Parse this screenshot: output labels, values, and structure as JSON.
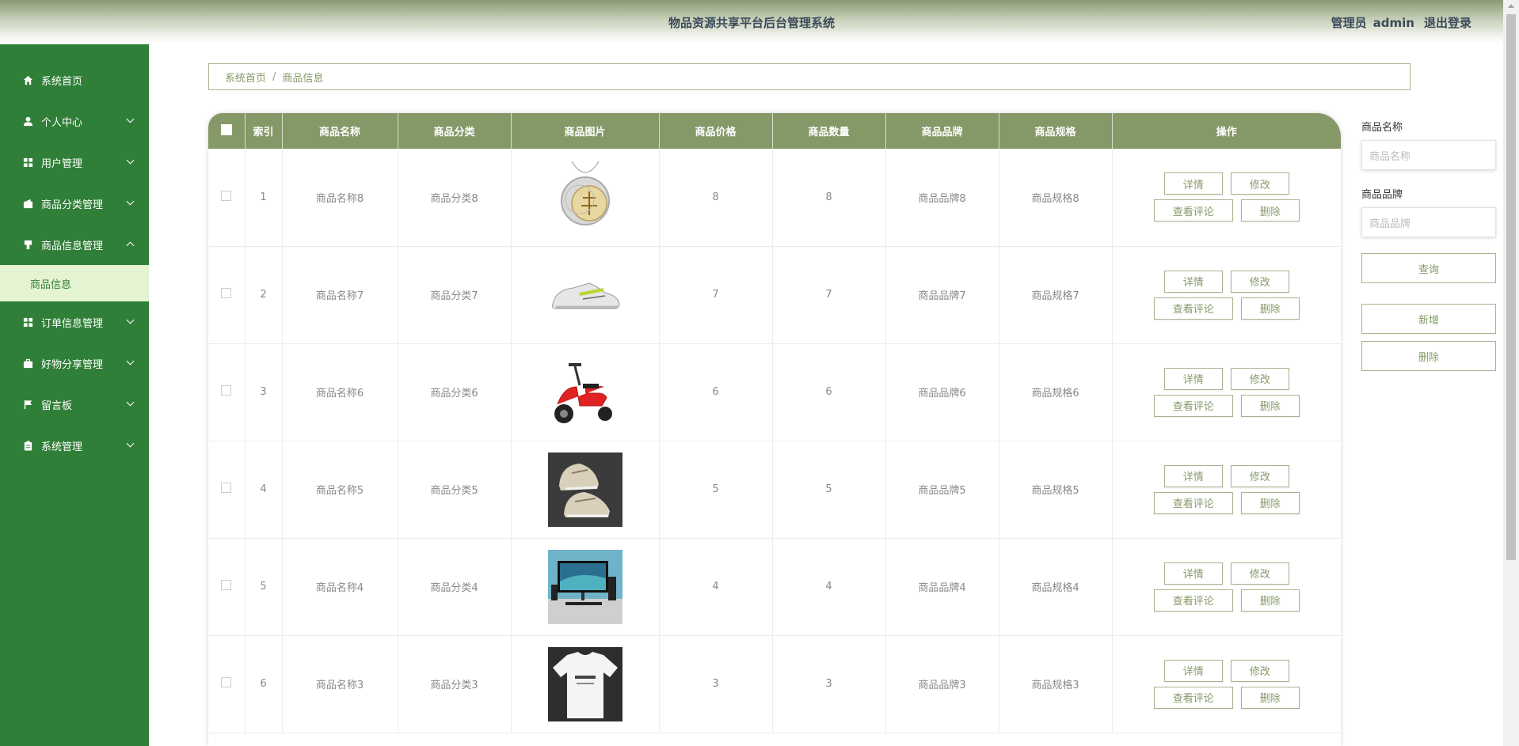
{
  "header": {
    "title": "物品资源共享平台后台管理系统",
    "role": "管理员",
    "username": "admin",
    "logout": "退出登录"
  },
  "sidebar": {
    "items": [
      {
        "label": "系统首页",
        "icon": "home-icon"
      },
      {
        "label": "个人中心",
        "icon": "user-icon"
      },
      {
        "label": "用户管理",
        "icon": "grid-icon"
      },
      {
        "label": "商品分类管理",
        "icon": "wallet-icon"
      },
      {
        "label": "商品信息管理",
        "icon": "cup-icon"
      },
      {
        "label": "订单信息管理",
        "icon": "grid-icon"
      },
      {
        "label": "好物分享管理",
        "icon": "briefcase-icon"
      },
      {
        "label": "留言板",
        "icon": "flag-icon"
      },
      {
        "label": "系统管理",
        "icon": "clipboard-icon"
      }
    ],
    "subitem": "商品信息"
  },
  "breadcrumb": {
    "home": "系统首页",
    "sep": "/",
    "current": "商品信息"
  },
  "table": {
    "headers": [
      "索引",
      "商品名称",
      "商品分类",
      "商品图片",
      "商品价格",
      "商品数量",
      "商品品牌",
      "商品规格",
      "操作"
    ],
    "rows": [
      {
        "index": "1",
        "name": "商品名称8",
        "category": "商品分类8",
        "image": "necklace",
        "price": "8",
        "qty": "8",
        "brand": "商品品牌8",
        "spec": "商品规格8"
      },
      {
        "index": "2",
        "name": "商品名称7",
        "category": "商品分类7",
        "image": "sneaker",
        "price": "7",
        "qty": "7",
        "brand": "商品品牌7",
        "spec": "商品规格7"
      },
      {
        "index": "3",
        "name": "商品名称6",
        "category": "商品分类6",
        "image": "scooter",
        "price": "6",
        "qty": "6",
        "brand": "商品品牌6",
        "spec": "商品规格6"
      },
      {
        "index": "4",
        "name": "商品名称5",
        "category": "商品分类5",
        "image": "shoes",
        "price": "5",
        "qty": "5",
        "brand": "商品品牌5",
        "spec": "商品规格5"
      },
      {
        "index": "5",
        "name": "商品名称4",
        "category": "商品分类4",
        "image": "monitor",
        "price": "4",
        "qty": "4",
        "brand": "商品品牌4",
        "spec": "商品规格4"
      },
      {
        "index": "6",
        "name": "商品名称3",
        "category": "商品分类3",
        "image": "tshirt",
        "price": "3",
        "qty": "3",
        "brand": "商品品牌3",
        "spec": "商品规格3"
      }
    ],
    "actions": {
      "detail": "详情",
      "edit": "修改",
      "comments": "查看评论",
      "delete": "删除"
    }
  },
  "search": {
    "name_label": "商品名称",
    "name_placeholder": "商品名称",
    "brand_label": "商品品牌",
    "brand_placeholder": "商品品牌",
    "query": "查询",
    "add": "新增",
    "delete": "删除"
  },
  "colors": {
    "sidebar": "#307f38",
    "accent": "#859968",
    "submenu_bg": "#e4f3d2"
  }
}
